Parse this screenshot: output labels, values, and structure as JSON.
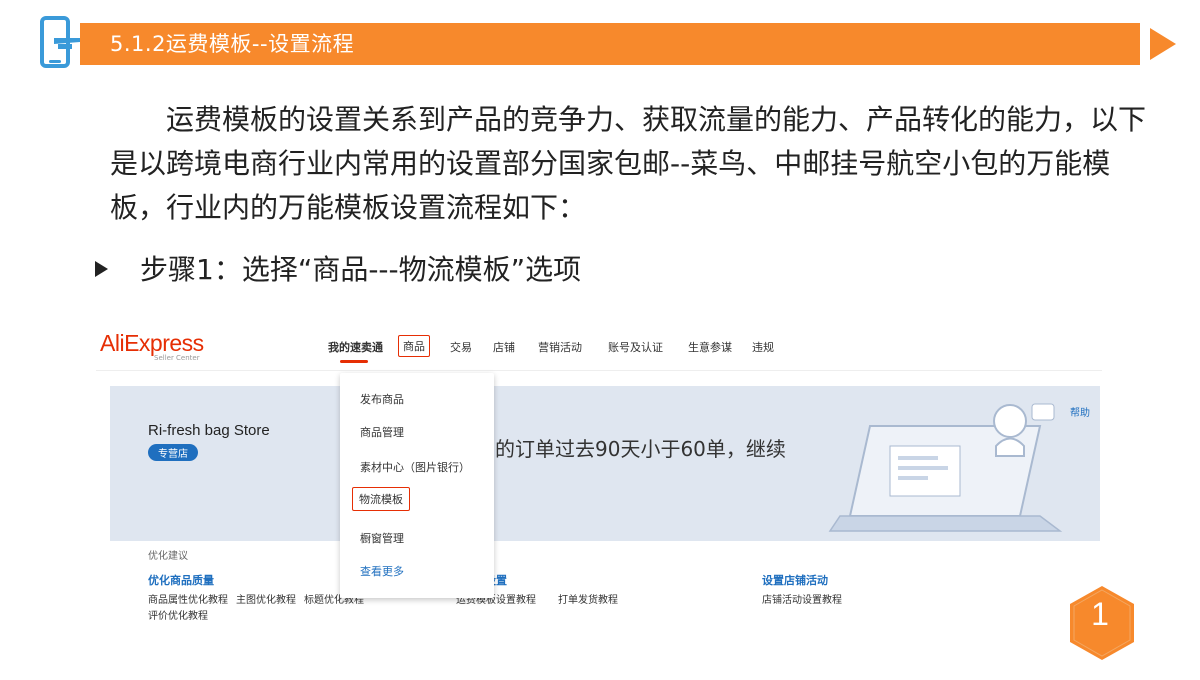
{
  "slide": {
    "title": "5.1.2运费模板--设置流程",
    "intro": "运费模板的设置关系到产品的竞争力、获取流量的能力、产品转化的能力，以下是以跨境电商行业内常用的设置部分国家包邮--菜鸟、中邮挂号航空小包的万能模板，行业内的万能模板设置流程如下：",
    "step": "步骤1：选择“商品---物流模板”选项",
    "page_number": "1",
    "accent_color": "#f7892c",
    "header_icon": "phone-hand-icon",
    "bullet_icon": "triangle-bullet-icon"
  },
  "screenshot": {
    "logo": {
      "ali": "Ali",
      "express": "Express",
      "sub": "Seller Center"
    },
    "nav": [
      {
        "label": "我的速卖通",
        "state": "active"
      },
      {
        "label": "商品",
        "state": "highlighted"
      },
      {
        "label": "交易"
      },
      {
        "label": "店铺"
      },
      {
        "label": "营销活动"
      },
      {
        "label": "账号及认证"
      },
      {
        "label": "生意参谋"
      },
      {
        "label": "违规"
      }
    ],
    "dropdown": [
      {
        "label": "发布商品"
      },
      {
        "label": "商品管理"
      },
      {
        "label": "素材中心（图片银行）"
      },
      {
        "label": "物流模板",
        "state": "highlighted"
      },
      {
        "label": "橱窗管理"
      },
      {
        "label": "查看更多",
        "state": "link"
      }
    ],
    "store": {
      "name": "Ri-fresh bag Store",
      "badge": "专营店",
      "message": "的订单过去90天小于60单，继续",
      "help": "帮助"
    },
    "suggestions": {
      "label": "优化建议",
      "groups": [
        {
          "title": "优化商品质量",
          "links": [
            "商品属性优化教程",
            "主图优化教程",
            "标题优化教程",
            "评价优化教程"
          ]
        },
        {
          "title": "流设置",
          "links": [
            "运费模板设置教程",
            "打单发货教程"
          ]
        },
        {
          "title": "设置店铺活动",
          "links": [
            "店铺活动设置教程"
          ]
        }
      ]
    },
    "colors": {
      "brand_red": "#e62e04",
      "link_blue": "#1f6fbf",
      "banner_bg": "#dfe6f0"
    }
  }
}
